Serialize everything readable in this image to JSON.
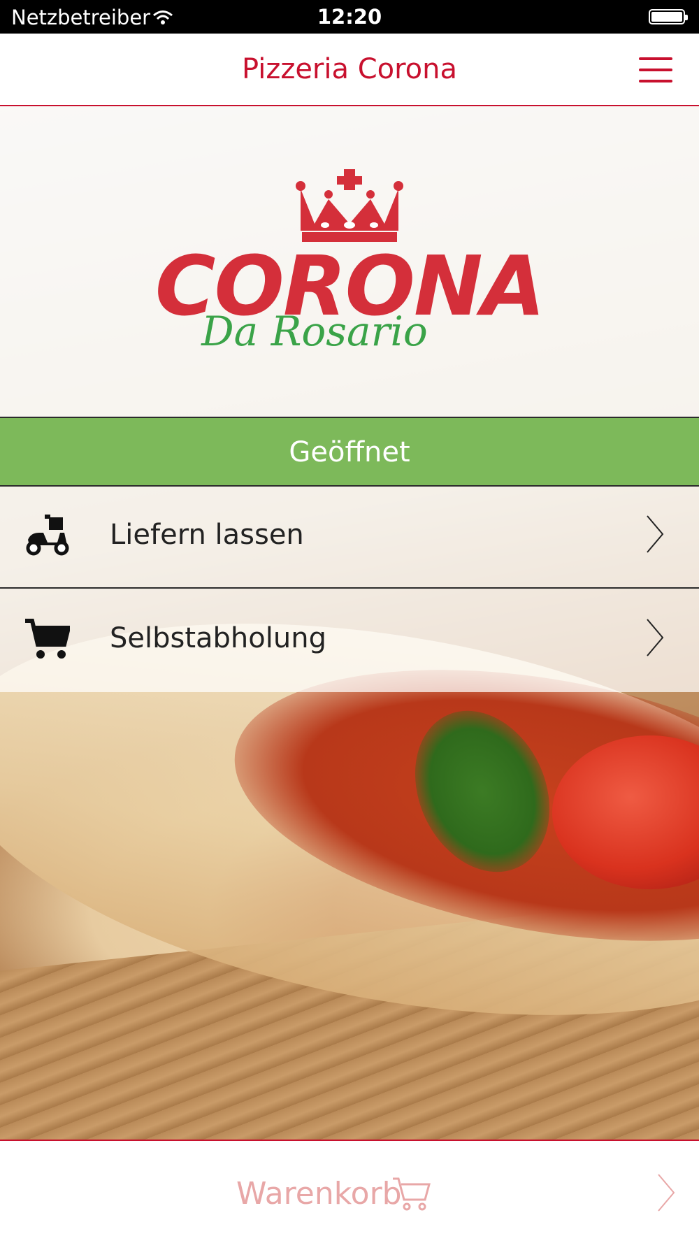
{
  "status_bar": {
    "carrier": "Netzbetreiber",
    "time": "12:20",
    "wifi_icon": "wifi-icon",
    "battery_icon": "battery-icon"
  },
  "navbar": {
    "title": "Pizzeria Corona",
    "menu_icon": "hamburger-menu-icon"
  },
  "logo": {
    "brand": "CORONA",
    "subtitle": "Da Rosario",
    "icon": "crown-icon"
  },
  "open_status": {
    "label": "Geöffnet",
    "color": "#7db95a"
  },
  "options": [
    {
      "label": "Liefern lassen",
      "icon": "delivery-scooter-icon"
    },
    {
      "label": "Selbstabholung",
      "icon": "shopping-cart-icon"
    }
  ],
  "footer": {
    "cart_label": "Warenkorb",
    "cart_icon": "shopping-cart-icon"
  },
  "colors": {
    "accent": "#c8102e",
    "brand_red": "#d42f3a",
    "brand_green": "#3aa348"
  }
}
